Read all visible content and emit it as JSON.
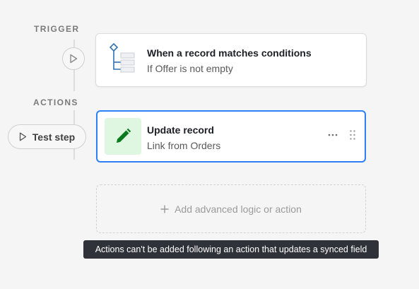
{
  "trigger": {
    "section_label": "TRIGGER",
    "title": "When a record matches conditions",
    "subtitle": "If Offer is not empty",
    "icon": "conditions-tree-icon"
  },
  "actions": {
    "section_label": "ACTIONS",
    "test_step_label": "Test step",
    "card": {
      "title": "Update record",
      "subtitle": "Link from Orders",
      "icon": "pencil-icon"
    },
    "add_label": "Add advanced logic or action",
    "tooltip": "Actions can't be added following an action that updates a synced field"
  },
  "colors": {
    "accent_blue": "#2d7ff9",
    "pencil_green": "#0b7a1e",
    "pencil_bg": "#dff6e1",
    "trigger_icon_blue": "#2f6fb4",
    "tooltip_bg": "#2f3238"
  }
}
